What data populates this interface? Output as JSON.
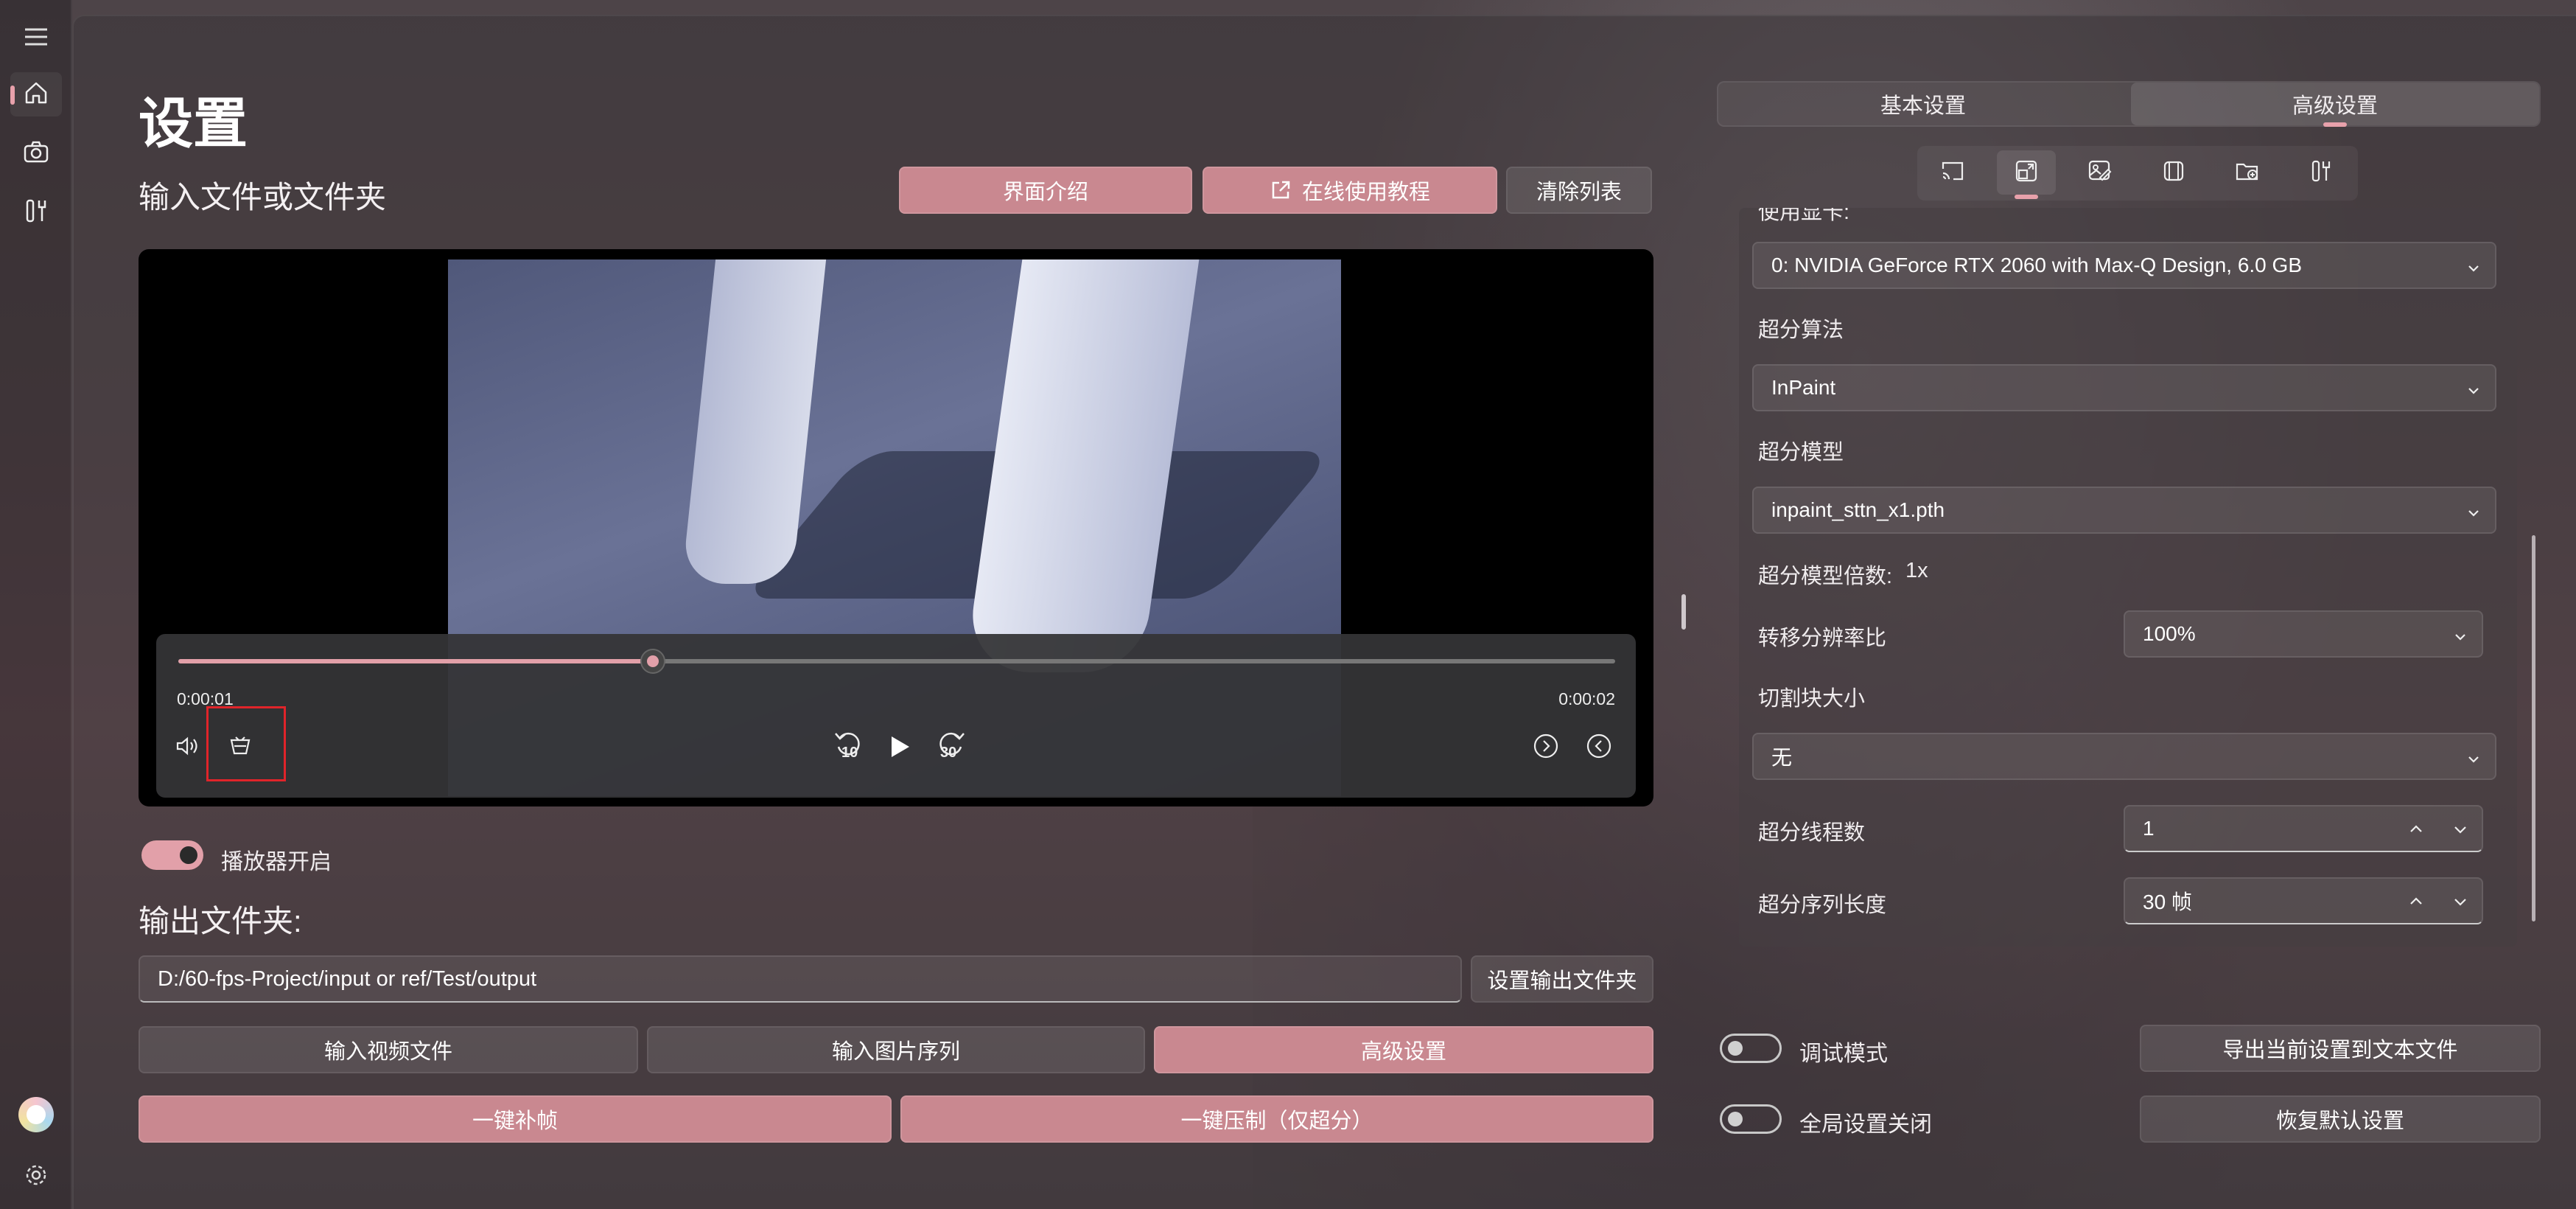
{
  "nav": {
    "menu_icon": "hamburger-icon",
    "items": [
      {
        "icon": "home-icon",
        "selected": true
      },
      {
        "icon": "camera-icon"
      },
      {
        "icon": "tools-icon"
      }
    ],
    "avatar_icon": "avatar-icon",
    "settings_icon": "gear-icon"
  },
  "page": {
    "title": "设置",
    "input_heading": "输入文件或文件夹",
    "output_heading": "输出文件夹:"
  },
  "top_buttons": {
    "intro": "界面介绍",
    "tutorial": "在线使用教程",
    "clear": "清除列表"
  },
  "player": {
    "current_time": "0:00:01",
    "total_time": "0:00:02",
    "progress": 0.33,
    "skip_back": "10",
    "skip_forward": "30"
  },
  "player_toggle": {
    "label": "播放器开启",
    "on": true
  },
  "output": {
    "path": "D:/60-fps-Project/input or ref/Test/output",
    "set_button": "设置输出文件夹"
  },
  "actions": {
    "input_video": "输入视频文件",
    "input_images": "输入图片序列",
    "advanced": "高级设置",
    "interpolate": "一键补帧",
    "compress": "一键压制（仅超分）"
  },
  "right": {
    "seg_basic": "基本设置",
    "seg_advanced": "高级设置",
    "tabs": [
      "cast-icon",
      "resize-icon",
      "image-edit-icon",
      "frame-icon",
      "folder-add-icon",
      "tools-icon"
    ],
    "gpu_label_partial": "使用显卡:",
    "gpu": "0: NVIDIA GeForce RTX 2060 with Max-Q Design, 6.0 GB",
    "algo_label": "超分算法",
    "algo": "InPaint",
    "model_label": "超分模型",
    "model": "inpaint_sttn_x1.pth",
    "scale_label": "超分模型倍数:",
    "scale": "1x",
    "res_label": "转移分辨率比",
    "res": "100%",
    "tile_label": "切割块大小",
    "tile": "无",
    "threads_label": "超分线程数",
    "threads": "1",
    "seq_label": "超分序列长度",
    "seq": "30 帧"
  },
  "bottom": {
    "debug_label": "调试模式",
    "global_label": "全局设置关闭",
    "export": "导出当前设置到文本文件",
    "restore": "恢复默认设置"
  },
  "colors": {
    "accent": "#c98890",
    "accent_light": "#e2a0a9"
  }
}
